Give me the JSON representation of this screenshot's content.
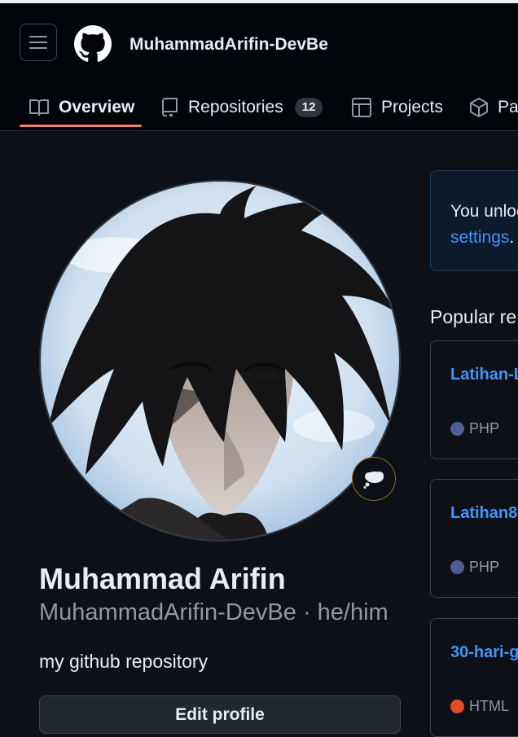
{
  "header": {
    "username": "MuhammadArifin-DevBe",
    "tabs": [
      {
        "label": "Overview"
      },
      {
        "label": "Repositories",
        "count": "12"
      },
      {
        "label": "Projects"
      },
      {
        "label": "Pa"
      }
    ]
  },
  "profile": {
    "full_name": "Muhammad Arifin",
    "login": "MuhammadArifin-DevBe",
    "separator": " · ",
    "pronouns": "he/him",
    "bio": "my github repository",
    "edit_button": "Edit profile",
    "status_icon": "thought-balloon-icon"
  },
  "notice": {
    "text": "You unloc",
    "link": "settings",
    "trailing": "."
  },
  "popular": {
    "title": "Popular re",
    "repos": [
      {
        "name": "Latihan-L",
        "language": "PHP",
        "color": "#4f5d95"
      },
      {
        "name": "Latihan8",
        "language": "PHP",
        "color": "#4f5d95"
      },
      {
        "name": "30-hari-g",
        "language": "HTML",
        "color": "#e34c26"
      }
    ]
  },
  "colors": {
    "accent": "#f78166",
    "link": "#4493f8",
    "background": "#0d1117"
  }
}
